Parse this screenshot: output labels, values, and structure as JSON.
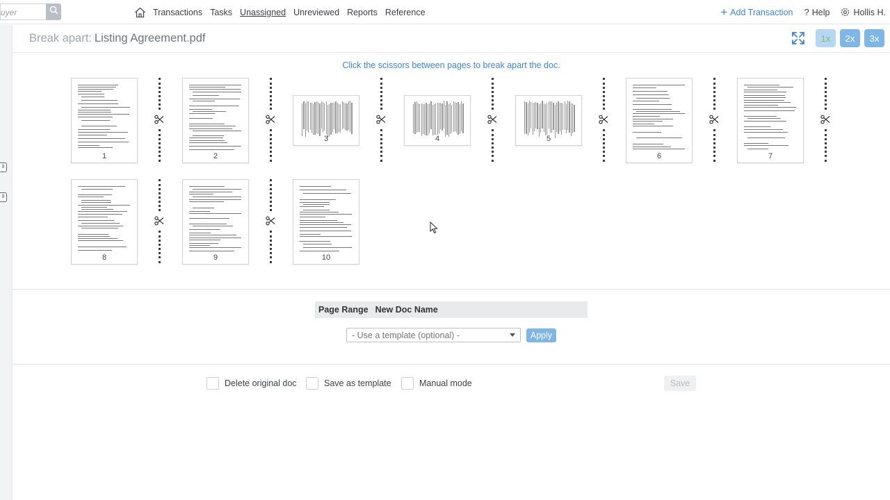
{
  "nav": {
    "search_placeholder": "uyer",
    "links": [
      "Transactions",
      "Tasks",
      "Unassigned",
      "Unreviewed",
      "Reports",
      "Reference"
    ],
    "active_link": "Unassigned",
    "add_transaction": "Add Transaction",
    "help": "Help",
    "user": "Hollis H."
  },
  "rail": {
    "tab_glyph": "ll"
  },
  "header": {
    "prefix": "Break apart:",
    "doc_name": "Listing Agreement.pdf",
    "zoom_options": [
      "1x",
      "2x",
      "3x"
    ],
    "zoom_active": "1x"
  },
  "instruction": "Click the scissors between pages to break apart the doc.",
  "pages": [
    {
      "num": "1",
      "orientation": "portrait"
    },
    {
      "num": "2",
      "orientation": "portrait"
    },
    {
      "num": "3",
      "orientation": "landscape"
    },
    {
      "num": "4",
      "orientation": "landscape"
    },
    {
      "num": "5",
      "orientation": "landscape"
    },
    {
      "num": "6",
      "orientation": "portrait"
    },
    {
      "num": "7",
      "orientation": "portrait"
    },
    {
      "num": "8",
      "orientation": "portrait"
    },
    {
      "num": "9",
      "orientation": "portrait"
    },
    {
      "num": "10",
      "orientation": "portrait"
    }
  ],
  "icons": {
    "home": "home-icon",
    "search": "search-icon",
    "scissors": "scissors-icon",
    "expand": "expand-icon",
    "gear": "gear-icon"
  },
  "range_table": {
    "col_page_range": "Page Range",
    "col_new_doc_name": "New Doc Name",
    "template_placeholder": "- Use a template (optional) -",
    "apply": "Apply"
  },
  "options": {
    "delete_original": "Delete original doc",
    "save_as_template": "Save as template",
    "manual_mode": "Manual mode",
    "save": "Save"
  },
  "colors": {
    "accent": "#3d84d8",
    "button_blue": "#7fb6e8",
    "active_zoom_bg": "#b6d7f3",
    "active_zoom_text": "#7fbf5e"
  }
}
